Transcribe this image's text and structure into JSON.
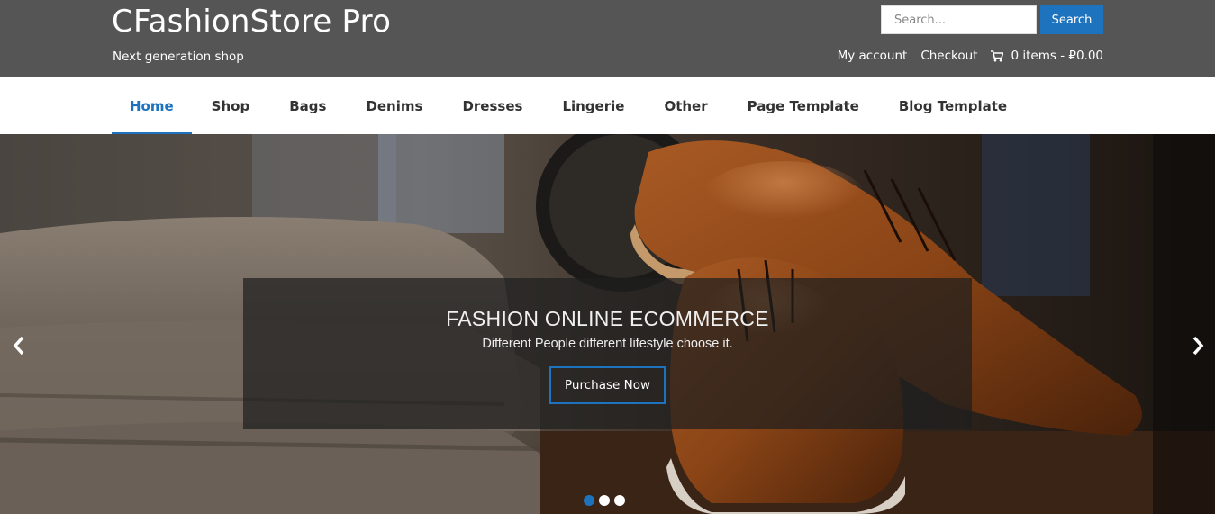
{
  "header": {
    "site_title": "CFashionStore Pro",
    "tagline": "Next generation shop",
    "search": {
      "placeholder": "Search...",
      "button_label": "Search"
    },
    "account_link": "My account",
    "checkout_link": "Checkout",
    "cart_summary": "0 items - ₽0.00",
    "cart_icon": "shopping-cart-icon"
  },
  "nav": {
    "items": [
      {
        "label": "Home",
        "active": true
      },
      {
        "label": "Shop"
      },
      {
        "label": "Bags"
      },
      {
        "label": "Denims"
      },
      {
        "label": "Dresses"
      },
      {
        "label": "Lingerie"
      },
      {
        "label": "Other"
      },
      {
        "label": "Page Template"
      },
      {
        "label": "Blog Template"
      }
    ]
  },
  "slider": {
    "title": "FASHION ONLINE ECOMMERCE",
    "subtitle": "Different People different lifestyle choose it.",
    "button_label": "Purchase Now",
    "prev_icon": "chevron-left-icon",
    "next_icon": "chevron-right-icon",
    "slide_count": 3,
    "active_slide": 1
  },
  "colors": {
    "header_bg": "#555555",
    "accent": "#1e73be",
    "nav_text": "#333333"
  }
}
